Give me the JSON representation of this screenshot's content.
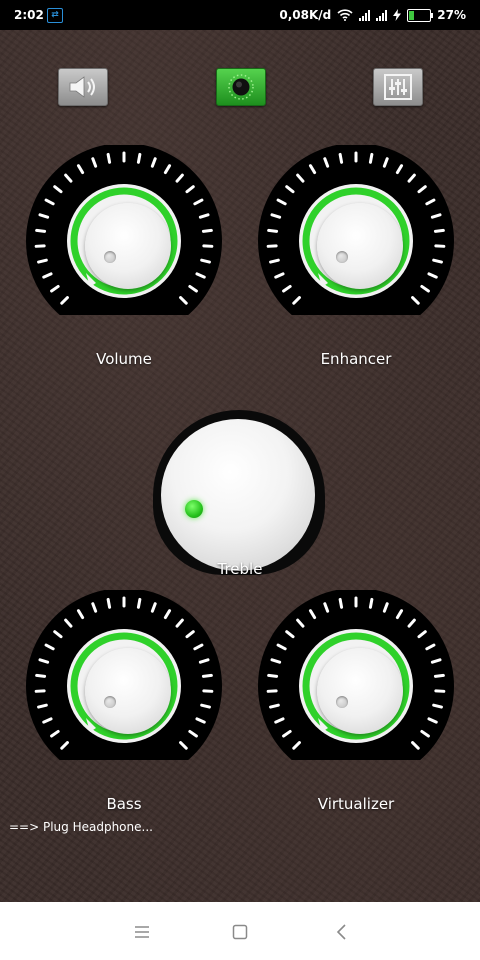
{
  "status_bar": {
    "time": "2:02",
    "network_speed": "0,08K/d",
    "battery_percent": "27%",
    "battery_level": 0.27,
    "icons": [
      "notification-icon",
      "wifi-icon",
      "signal-icon",
      "signal-icon",
      "charging-icon",
      "battery-icon"
    ]
  },
  "toolbar": {
    "buttons": [
      {
        "icon": "speaker-icon",
        "style": "gray"
      },
      {
        "icon": "knob-icon",
        "style": "green",
        "active": true
      },
      {
        "icon": "equalizer-icon",
        "style": "gray"
      }
    ]
  },
  "knobs": {
    "volume": {
      "label": "Volume"
    },
    "enhancer": {
      "label": "Enhancer"
    },
    "treble": {
      "label": "Treble"
    },
    "bass": {
      "label": "Bass"
    },
    "virtualizer": {
      "label": "Virtualizer"
    }
  },
  "hint_text": "==> Plug Headphone...",
  "colors": {
    "accent_green": "#2fd12a",
    "leather_bg": "#3b2d2a",
    "dial_bg": "#000000"
  },
  "navigation": {
    "icons": [
      "menu-icon",
      "home-icon",
      "back-icon"
    ]
  }
}
